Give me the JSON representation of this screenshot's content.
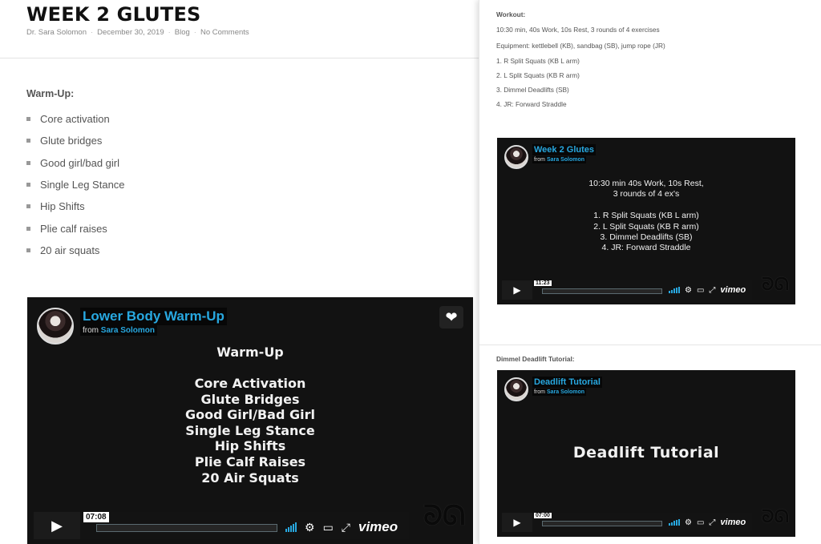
{
  "post": {
    "title": "WEEK 2 GLUTES",
    "author": "Dr. Sara Solomon",
    "date": "December 30, 2019",
    "category": "Blog",
    "comments": "No Comments"
  },
  "warmup": {
    "heading": "Warm-Up:",
    "items": [
      "Core activation",
      "Glute bridges",
      "Good girl/bad girl",
      "Single Leg Stance",
      "Hip Shifts",
      "Plie calf raises",
      "20 air squats"
    ]
  },
  "video_warmup": {
    "title": "Lower Body Warm-Up",
    "from_label": "from",
    "author": "Sara Solomon",
    "heading": "Warm-Up",
    "lines": [
      "Core Activation",
      "Glute Bridges",
      "Good Girl/Bad Girl",
      "Single Leg Stance",
      "Hip Shifts",
      "Plie Calf Raises",
      "20 Air Squats"
    ],
    "time": "07:08",
    "logo": "vimeo"
  },
  "workout": {
    "heading": "Workout:",
    "summary": "10:30 min,  40s Work, 10s Rest, 3 rounds of 4 exercises",
    "equipment": "Equipment: kettlebell (KB), sandbag (SB), jump rope (JR)",
    "exercises": [
      "1.  R Split Squats (KB L arm)",
      "2.  L Split Squats (KB R arm)",
      "3.  Dimmel Deadlifts (SB)",
      "4.  JR: Forward Straddle"
    ]
  },
  "video_glutes": {
    "title": "Week 2 Glutes",
    "from_label": "from",
    "author": "Sara Solomon",
    "lines": [
      "10:30 min 40s Work, 10s Rest,",
      "3 rounds of 4 ex's",
      "",
      "1. R Split Squats (KB L arm)",
      "2. L Split Squats (KB R arm)",
      "3. Dimmel Deadlifts (SB)",
      "4. JR: Forward Straddle"
    ],
    "time": "11:23",
    "logo": "vimeo"
  },
  "deadlift": {
    "heading": "Dimmel Deadlift Tutorial:"
  },
  "video_deadlift": {
    "title": "Deadlift Tutorial",
    "from_label": "from",
    "author": "Sara Solomon",
    "body": "Deadlift Tutorial",
    "time": "07:00",
    "logo": "vimeo"
  },
  "icons": {
    "play": "play-icon",
    "volume": "volume-bars-icon",
    "settings": "gear-icon",
    "pip": "pip-icon",
    "fullscreen": "fullscreen-icon",
    "like": "heart-icon"
  },
  "colors": {
    "accent": "#28a8e0",
    "player_bg": "#121212"
  }
}
